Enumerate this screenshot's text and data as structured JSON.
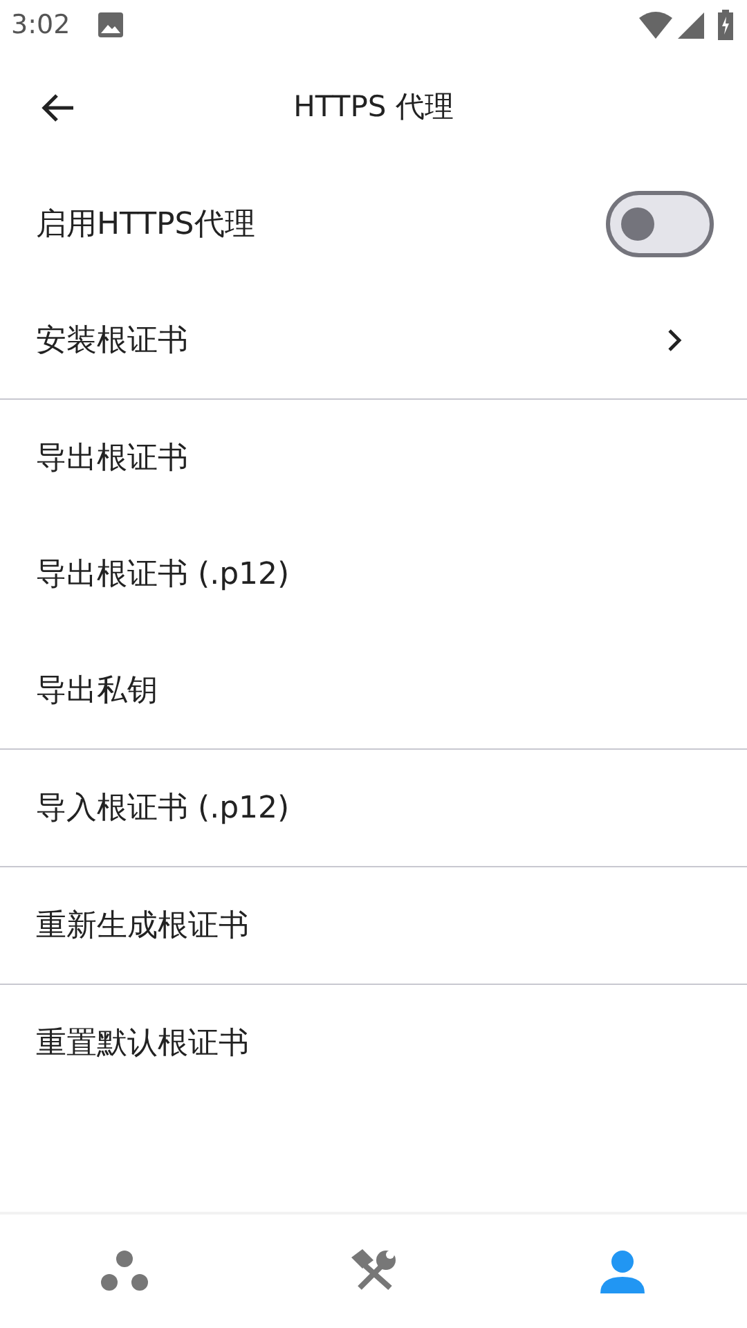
{
  "status_bar": {
    "time": "3:02"
  },
  "toolbar": {
    "title": "HTTPS 代理"
  },
  "groups": [
    {
      "items": [
        {
          "kind": "toggle",
          "label": "启用HTTPS代理",
          "on": false
        },
        {
          "kind": "link",
          "label": "安装根证书"
        }
      ]
    },
    {
      "items": [
        {
          "kind": "action",
          "label": "导出根证书"
        },
        {
          "kind": "action",
          "label": "导出根证书 (.p12)"
        },
        {
          "kind": "action",
          "label": "导出私钥"
        }
      ]
    },
    {
      "items": [
        {
          "kind": "action",
          "label": "导入根证书 (.p12)"
        }
      ]
    },
    {
      "items": [
        {
          "kind": "action",
          "label": "重新生成根证书"
        }
      ]
    },
    {
      "items": [
        {
          "kind": "action",
          "label": "重置默认根证书"
        }
      ]
    }
  ],
  "bottom_nav": [
    {
      "kind": "dots",
      "selected": false
    },
    {
      "kind": "tools",
      "selected": false
    },
    {
      "kind": "person",
      "selected": true
    }
  ]
}
